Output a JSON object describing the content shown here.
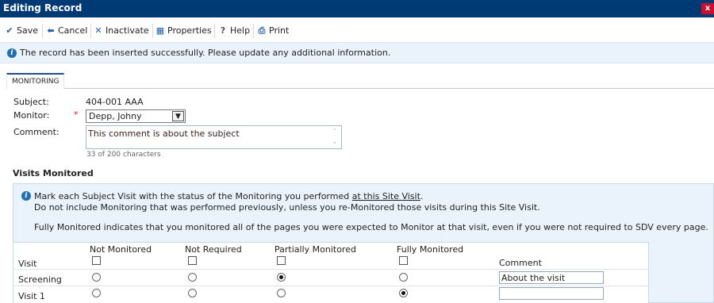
{
  "window": {
    "title": "Editing Record",
    "close_label": "x"
  },
  "toolbar": {
    "save_label": "Save",
    "cancel_label": "Cancel",
    "inactivate_label": "Inactivate",
    "properties_label": "Properties",
    "help_label": "Help",
    "print_label": "Print"
  },
  "alert": {
    "message": "The record has been inserted successfully. Please update any additional information."
  },
  "tabs": [
    {
      "label": "MONITORING"
    }
  ],
  "form": {
    "subject_label": "Subject:",
    "subject_value": "404-001 AAA",
    "monitor_label": "Monitor:",
    "monitor_required": "*",
    "monitor_value": "Depp, Johny",
    "comment_label": "Comment:",
    "comment_value": "This comment is about the subject",
    "char_count": "33 of 200 characters"
  },
  "visits": {
    "section_title": "Visits Monitored",
    "note_line1_prefix": "Mark each Subject Visit with the status of the Monitoring you performed ",
    "note_line1_link": "at this Site Visit",
    "note_line1_suffix": ".",
    "note_line2": "Do not include Monitoring that was performed previously, unless you re-Monitored those visits during this Site Visit.",
    "note_line3": "Fully Monitored indicates that you monitored all of the pages you were expected to Monitor at that visit, even if you were not required to SDV every page.",
    "columns": {
      "visit": "Visit",
      "not_monitored": "Not Monitored",
      "not_required": "Not Required",
      "partially_monitored": "Partially Monitored",
      "fully_monitored": "Fully Monitored",
      "comment": "Comment"
    },
    "rows": [
      {
        "visit": "Screening",
        "selected": "partially_monitored",
        "comment": "About the visit"
      },
      {
        "visit": "Visit 1",
        "selected": "fully_monitored",
        "comment": ""
      }
    ]
  }
}
